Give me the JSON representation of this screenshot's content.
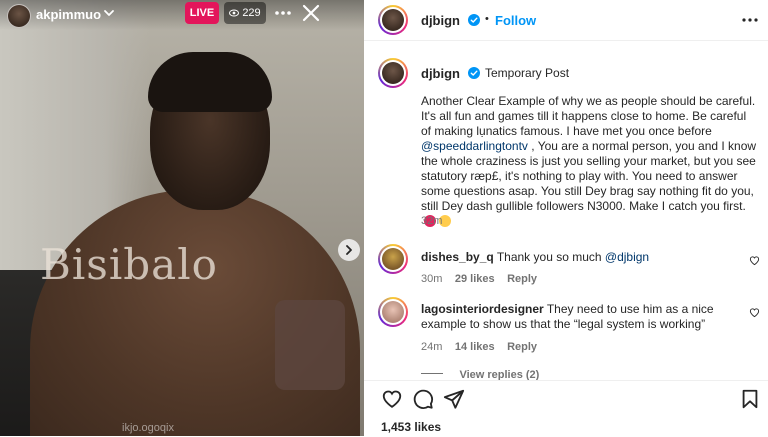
{
  "live": {
    "host_username": "akpimmuo",
    "live_label": "LIVE",
    "viewer_count": "229",
    "watermark": "Bisibalo",
    "bottom_caption": "ikjo.ogoqix"
  },
  "post": {
    "author": "djbign",
    "follow_label": "Follow",
    "caption_tag": "Temporary Post",
    "caption_part1": "Another Clear Example of why we as people should be careful. It's all fun and games till it happens close to home. Be careful of making lụnatics famous. I have met you once before ",
    "caption_mention": "@speeddarlingtontv",
    "caption_part2": " , You are a normal person, you and I know the whole craziness is just you selling your market, but you see statutory ræp£, it's nothing to play with. You need to answer some questions asap. You still Dey brag say nothing fit do you, still Dey dash gullible followers N3000. Make I catch you first.",
    "caption_time": "32m",
    "likes": "1,453 likes"
  },
  "comments": [
    {
      "username": "dishes_by_q",
      "text": "Thank you so much ",
      "mention": "@djbign",
      "time": "30m",
      "likes": "29 likes",
      "reply_label": "Reply"
    },
    {
      "username": "lagosinteriordesigner",
      "text": "They need to use him as a nice example to show us that the “legal system is working”",
      "time": "24m",
      "likes": "14 likes",
      "reply_label": "Reply",
      "view_replies": "View replies (2)"
    }
  ],
  "icons": {
    "verified": "verified-badge-icon",
    "heart": "heart-icon",
    "comment": "comment-icon",
    "share": "share-icon",
    "save": "bookmark-icon",
    "more": "more-dots-icon",
    "close": "close-icon",
    "next": "chevron-right-icon"
  },
  "colors": {
    "accent": "#0095f6",
    "live_badge": "#e3155b",
    "text": "#262626",
    "muted": "#737373",
    "mention": "#00376b"
  }
}
